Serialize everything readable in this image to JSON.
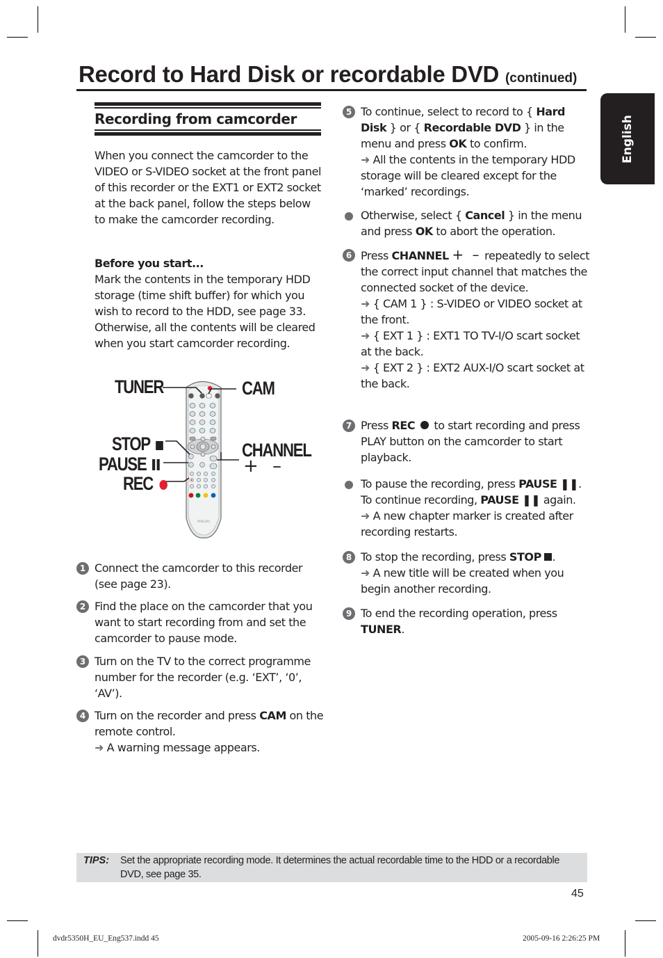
{
  "header": {
    "title": "Record to Hard Disk or recordable DVD",
    "title_suffix": "(continued)",
    "language_tab": "English"
  },
  "section": {
    "heading": "Recording from camcorder",
    "intro": "When you connect the camcorder to the VIDEO or S-VIDEO socket at the front panel of this recorder or the EXT1 or EXT2 socket at the back panel, follow the steps below to make the camcorder recording.",
    "before_heading": "Before you start...",
    "before_text": "Mark the contents in the temporary HDD storage (time shift buffer) for which you wish to record to the HDD, see page 33. Otherwise, all the contents will be cleared when you start camcorder recording."
  },
  "figure": {
    "callouts": {
      "tuner": "TUNER",
      "cam": "CAM",
      "stop": "STOP",
      "pause": "PAUSE",
      "rec": "REC",
      "channel": "CHANNEL",
      "channel_signs": "+ –"
    },
    "brand": "PHILIPS",
    "colors": {
      "rec": "#e31e2d",
      "red": "#c4161c",
      "green": "#00843d",
      "yellow": "#f5c400",
      "blue": "#0066b3"
    }
  },
  "steps_left": [
    {
      "num": "1",
      "text": "Connect the camcorder to this recorder (see page 23)."
    },
    {
      "num": "2",
      "text": "Find the place on the camcorder that you want to start recording from and set the camcorder to pause mode."
    },
    {
      "num": "3",
      "text": "Turn on the TV to the correct programme number for the recorder (e.g. ‘EXT’, ‘0’, ‘AV’)."
    },
    {
      "num": "4",
      "pre": "Turn on the recorder and press ",
      "bold": "CAM",
      "post": " on the remote control.",
      "result": "A warning message appears."
    }
  ],
  "steps_right": {
    "s5": {
      "num": "5",
      "t1": "To continue, select to record to { ",
      "b1": "Hard Disk",
      "t2": " } or { ",
      "b2": "Recordable DVD",
      "t3": " } in the menu and press ",
      "b3": "OK",
      "t4": " to confirm.",
      "result": "All the contents in the temporary HDD storage will be cleared except for the ‘marked’ recordings."
    },
    "b5": {
      "t1": "Otherwise, select { ",
      "b1": "Cancel",
      "t2": " } in the menu and press ",
      "b2": "OK",
      "t3": " to abort the operation."
    },
    "s6": {
      "num": "6",
      "t1": "Press ",
      "b1": "CHANNEL",
      "signs": "+ –",
      "t2": " repeatedly to select the correct input channel that matches the connected socket of the device.",
      "results": [
        "{ CAM 1 } : S-VIDEO or VIDEO socket at the front.",
        "{ EXT 1 } : EXT1 TO TV-I/O scart socket at the back.",
        "{ EXT 2 } : EXT2 AUX-I/O scart socket at the back."
      ]
    },
    "s7": {
      "num": "7",
      "t1": "Press ",
      "b1": "REC",
      "t2": " to start recording and press PLAY button on the camcorder to start playback."
    },
    "b7": {
      "t1": "To pause the recording, press ",
      "b1": "PAUSE",
      "t2": ".",
      "t3": "To continue recording, ",
      "b2": "PAUSE",
      "t4": " again.",
      "result": "A new chapter marker is created after recording restarts."
    },
    "s8": {
      "num": "8",
      "t1": "To stop the recording, press ",
      "b1": "STOP",
      "t2": ".",
      "result": "A new title will be created when you begin another recording."
    },
    "s9": {
      "num": "9",
      "t1": "To end the recording operation, press ",
      "b1": "TUNER",
      "t2": "."
    }
  },
  "tips": {
    "label": "TIPS:",
    "text": "Set the appropriate recording mode. It determines the actual recordable time to the HDD or a recordable DVD, see page 35."
  },
  "page_number": "45",
  "footer": {
    "file": "dvdr5350H_EU_Eng537.indd   45",
    "timestamp": "2005-09-16   2:26:25 PM"
  }
}
